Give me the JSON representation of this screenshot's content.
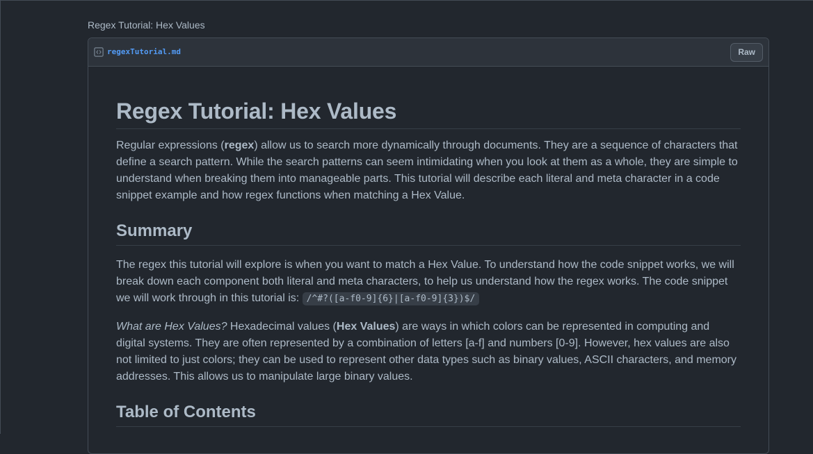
{
  "gist": {
    "title": "Regex Tutorial: Hex Values"
  },
  "file": {
    "name": "regexTutorial.md",
    "raw_label": "Raw",
    "icon": "code-square-icon"
  },
  "doc": {
    "h1": "Regex Tutorial: Hex Values",
    "intro": {
      "pre": "Regular expressions (",
      "bold": "regex",
      "post": ") allow us to search more dynamically through documents. They are a sequence of characters that define a search pattern. While the search patterns can seem intimidating when you look at them as a whole, they are simple to understand when breaking them into manageable parts. This tutorial will describe each literal and meta character in a code snippet example and how regex functions when matching a Hex Value."
    },
    "summary_heading": "Summary",
    "summary": {
      "text": "The regex this tutorial will explore is when you want to match a Hex Value. To understand how the code snippet works, we will break down each component both literal and meta characters, to help us understand how the regex works. The code snippet we will work through in this tutorial is: ",
      "code": "/^#?([a-f0-9]{6}|[a-f0-9]{3})$/"
    },
    "hex": {
      "italic": "What are Hex Values?",
      "pre": " Hexadecimal values (",
      "bold": "Hex Values",
      "post": ") are ways in which colors can be represented in computing and digital systems. They are often represented by a combination of letters [a-f] and numbers [0-9]. However, hex values are also not limited to just colors; they can be used to represent other data types such as binary values, ASCII characters, and memory addresses. This allows us to manipulate large binary values."
    },
    "toc_heading": "Table of Contents"
  },
  "colors": {
    "background": "#22272e",
    "text": "#adbac7",
    "link": "#539bf5",
    "border": "#444c56"
  }
}
